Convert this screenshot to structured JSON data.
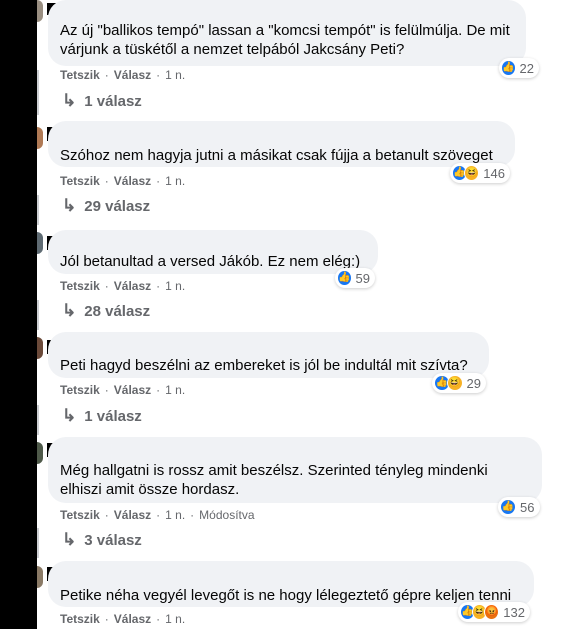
{
  "like_label": "Tetszik",
  "reply_label": "Válasz",
  "comments": [
    {
      "text": "Az új \"ballikos tempó\" lassan a \"komcsi tempót\" is felülmúlja. De mit\nvárjunk a tüskétől a nemzet telpából Jakcsány Peti?",
      "reactions": [
        "like"
      ],
      "reaction_count": "22",
      "time": "1 n.",
      "edited": "",
      "replies": "1 válasz"
    },
    {
      "text": "Szóhoz nem hagyja jutni a másikat csak fújja a betanult szöveget",
      "reactions": [
        "like",
        "haha"
      ],
      "reaction_count": "146",
      "time": "1 n.",
      "edited": "",
      "replies": "29 válasz"
    },
    {
      "text": "Jól betanultad a versed Jákób. Ez nem elég:)",
      "reactions": [
        "like"
      ],
      "reaction_count": "59",
      "time": "1 n.",
      "edited": "",
      "replies": "28 válasz"
    },
    {
      "text": "Peti hagyd beszélni az embereket is jól be indultál mit szívta?",
      "reactions": [
        "like",
        "haha"
      ],
      "reaction_count": "29",
      "time": "1 n.",
      "edited": "",
      "replies": "1 válasz"
    },
    {
      "text": "Még hallgatni is rossz amit beszélsz. Szerinted tényleg mindenki\nelhiszi amit össze hordasz.",
      "reactions": [
        "like"
      ],
      "reaction_count": "56",
      "time": "1 n.",
      "edited": "Módosítva",
      "replies": "3 válasz"
    },
    {
      "text": "Petike néha vegyél levegőt is ne hogy lélegeztető gépre keljen tenni",
      "reactions": [
        "like",
        "haha",
        "angry"
      ],
      "reaction_count": "132",
      "time": "1 n.",
      "edited": "",
      "replies": ""
    }
  ]
}
